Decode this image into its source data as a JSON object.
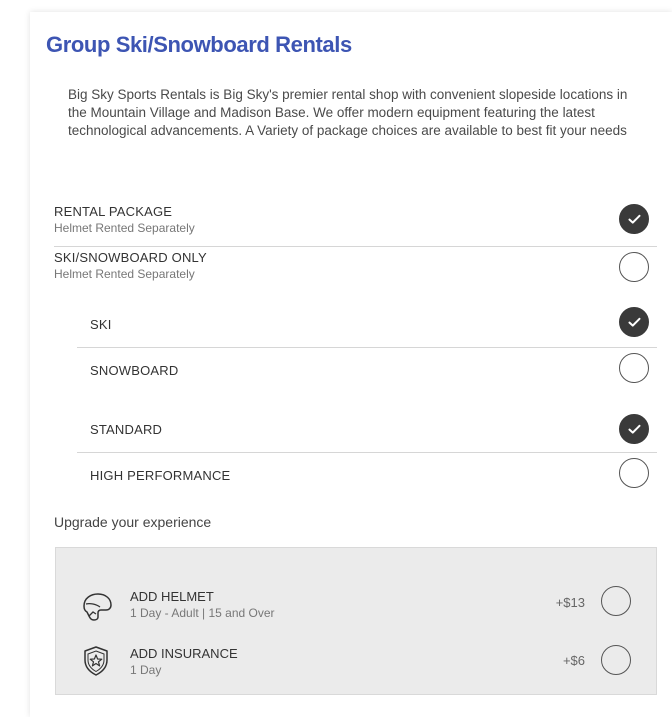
{
  "section": {
    "title": "Group Ski/Snowboard Rentals",
    "description": "Big Sky Sports Rentals is Big Sky's premier rental shop with convenient slopeside locations in the Mountain Village and Madison Base. We offer modern equipment featuring the latest technological advancements. A Variety of package choices are available to best fit your needs"
  },
  "package_options": [
    {
      "title": "RENTAL PACKAGE",
      "subtitle": "Helmet Rented Separately",
      "selected": true
    },
    {
      "title": "SKI/SNOWBOARD ONLY",
      "subtitle": "Helmet Rented Separately",
      "selected": false
    }
  ],
  "equipment_options": [
    {
      "title": "SKI",
      "selected": true
    },
    {
      "title": "SNOWBOARD",
      "selected": false
    }
  ],
  "performance_options": [
    {
      "title": "STANDARD",
      "selected": true
    },
    {
      "title": "HIGH PERFORMANCE",
      "selected": false
    }
  ],
  "upgrade": {
    "label": "Upgrade your experience",
    "addons": [
      {
        "title": "ADD HELMET",
        "subtitle": "1 Day - Adult | 15 and Over",
        "price": "+$13",
        "icon": "helmet-icon",
        "selected": false
      },
      {
        "title": "ADD INSURANCE",
        "subtitle": "1 Day",
        "price": "+$6",
        "icon": "shield-star-icon",
        "selected": false
      }
    ]
  },
  "colors": {
    "title": "#3d55b3",
    "checked": "#3a3a3a",
    "upgrade_background": "#ebebeb"
  }
}
